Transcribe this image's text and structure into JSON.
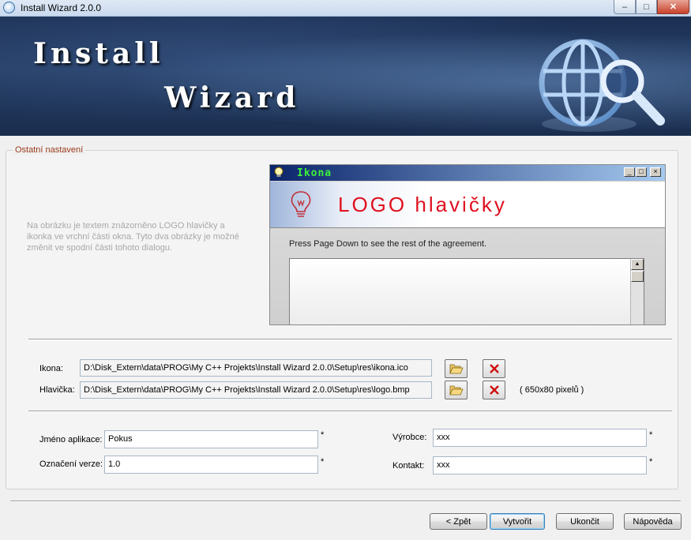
{
  "window": {
    "title": "Install Wizard 2.0.0"
  },
  "banner": {
    "word1": "Install",
    "word2": "Wizard"
  },
  "group": {
    "title": "Ostatní nastavení",
    "info_text": "Na obrázku je textem znázorněno LOGO hlavičky a ikonka ve vrchní části okna. Tyto dva obrázky je možné změnit ve spodní části tohoto dialogu."
  },
  "preview": {
    "title": "Ikona",
    "logo_text": "LOGO hlavičky",
    "agreement_text": "Press Page Down to see the rest of the agreement."
  },
  "files": {
    "icon_label": "Ikona:",
    "icon_path": "D:\\Disk_Extern\\data\\PROG\\My C++ Projekts\\Install Wizard 2.0.0\\Setup\\res\\ikona.ico",
    "header_label": "Hlavička:",
    "header_path": "D:\\Disk_Extern\\data\\PROG\\My C++ Projekts\\Install Wizard 2.0.0\\Setup\\res\\logo.bmp",
    "header_size_note": "( 650x80 pixelů )"
  },
  "form": {
    "app_name_label": "Jméno aplikace:",
    "app_name_value": "Pokus",
    "version_label": "Označení verze:",
    "version_value": "1.0",
    "vendor_label": "Výrobce:",
    "vendor_value": "xxx",
    "contact_label": "Kontakt:",
    "contact_value": "xxx",
    "required_mark": "*"
  },
  "buttons": {
    "back": "< Zpět",
    "create": "Vytvořit",
    "finish": "Ukončit",
    "help": "Nápověda"
  },
  "icons": {
    "app": "globe-icon",
    "open": "folder-open-icon",
    "delete": "red-x-icon",
    "bulb": "lightbulb-icon",
    "logo": "globe-magnifier-icon"
  },
  "colors": {
    "group_title": "#9a3a1a",
    "logo_text": "#e01020",
    "preview_title": "#3cf03c"
  }
}
